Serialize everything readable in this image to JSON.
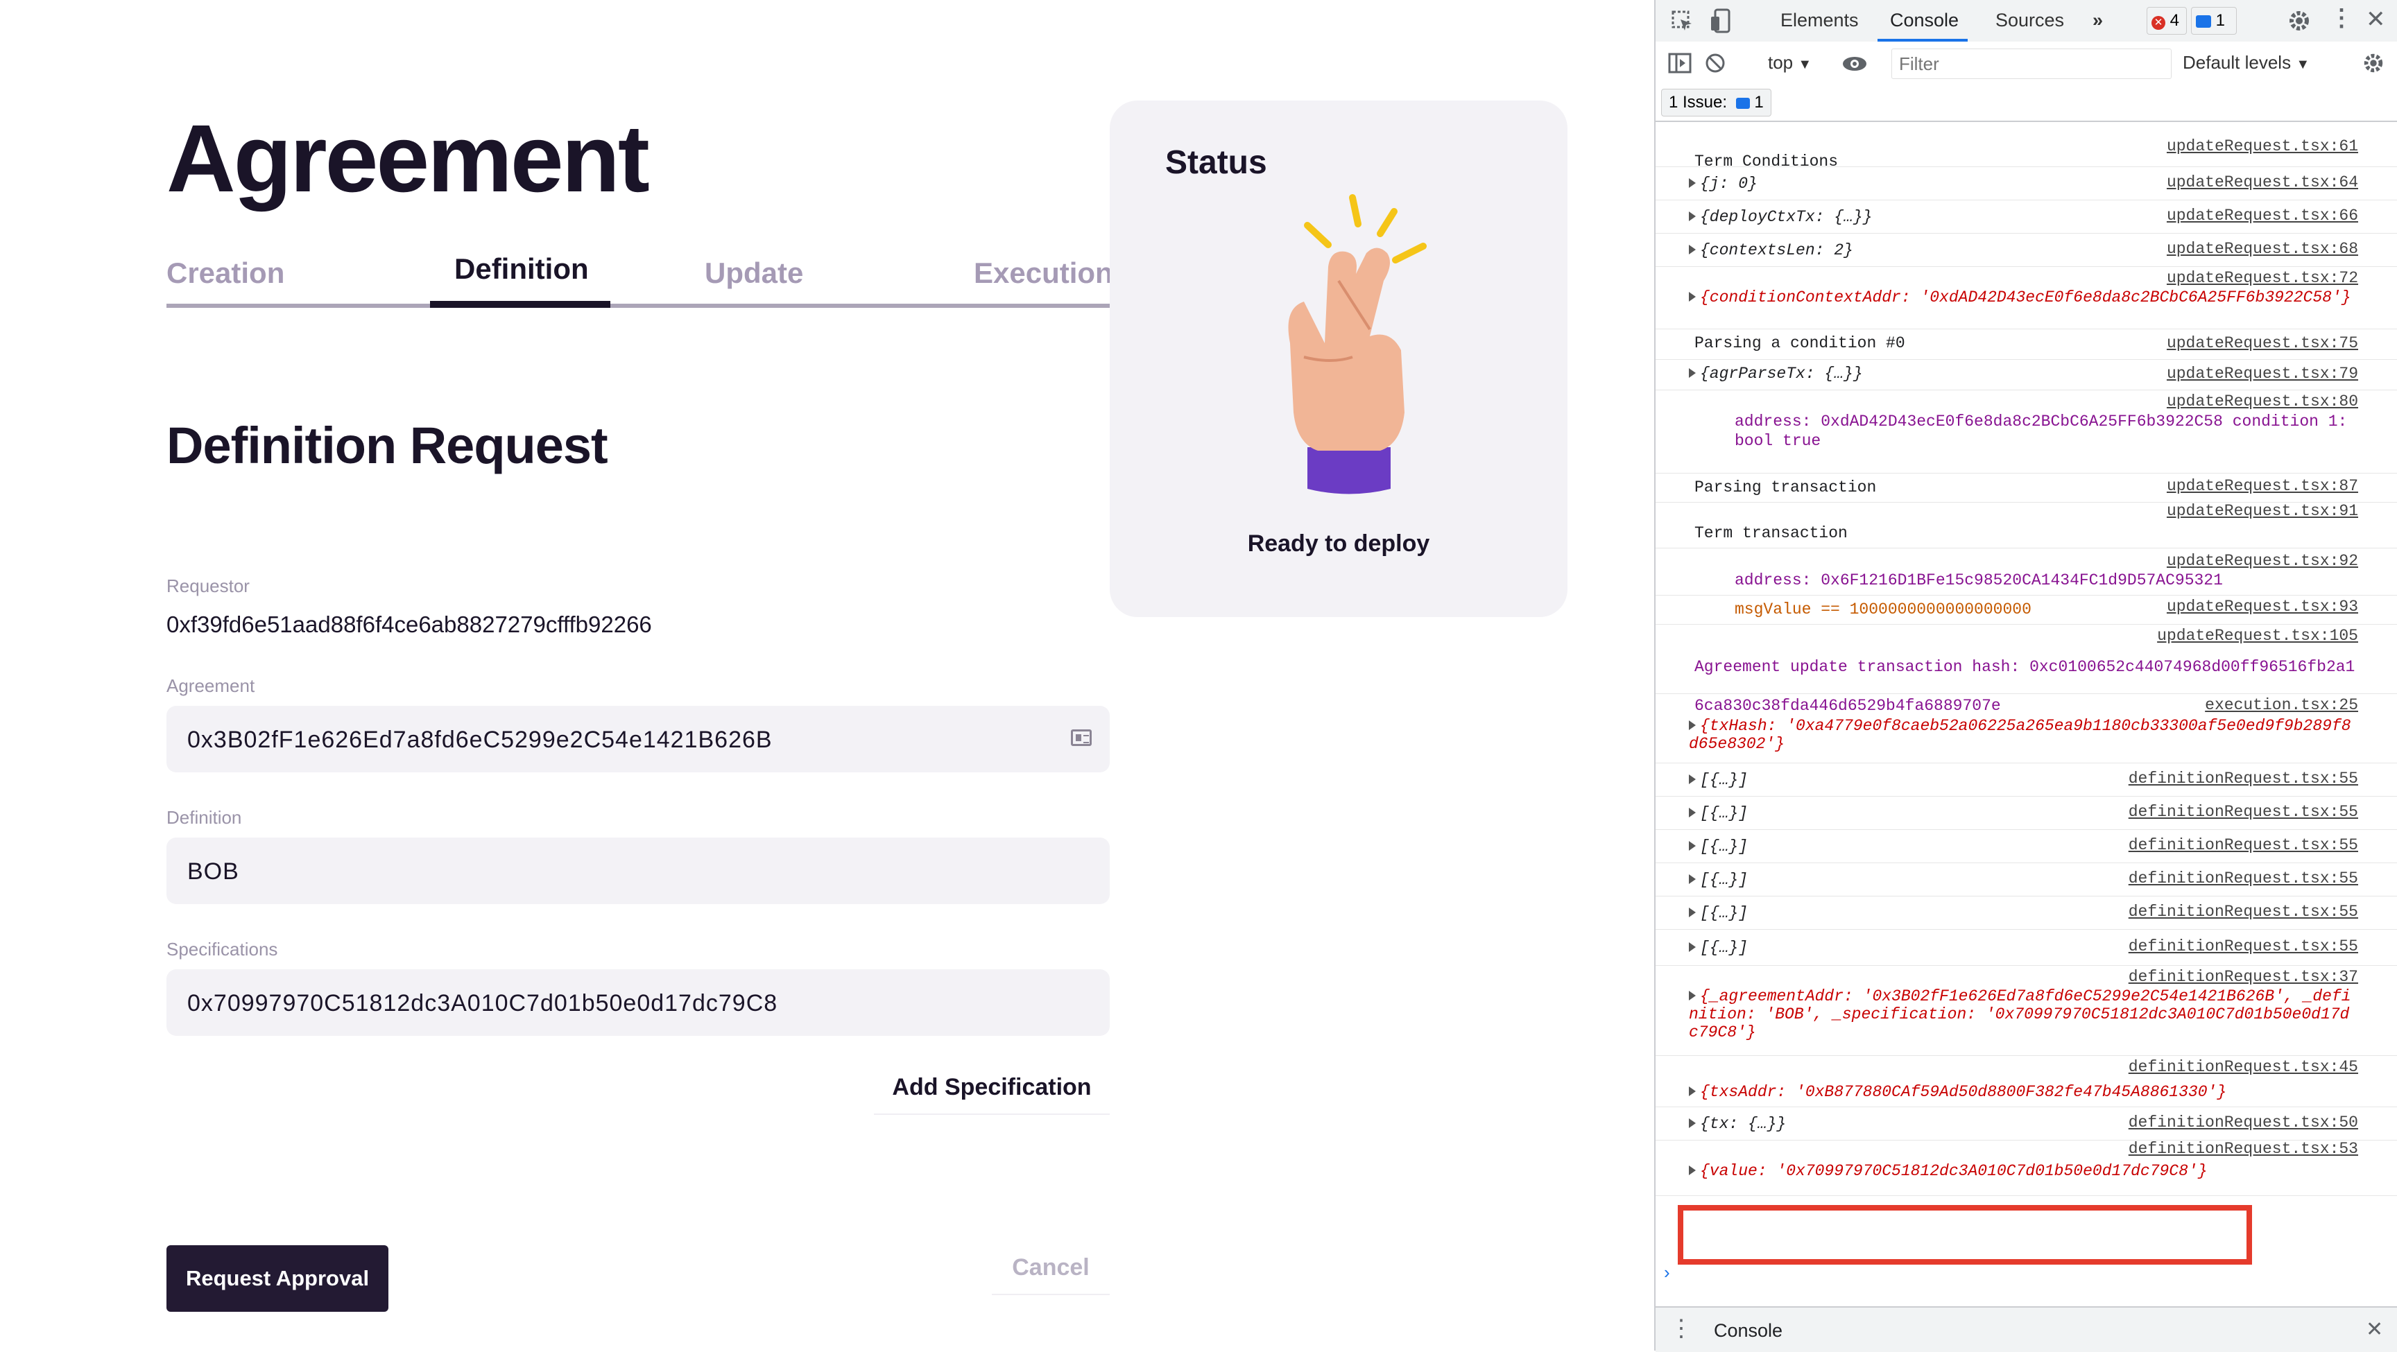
{
  "app": {
    "title": "Agreement",
    "tabs": [
      {
        "label": "Creation"
      },
      {
        "label": "Definition"
      },
      {
        "label": "Update"
      },
      {
        "label": "Execution"
      }
    ],
    "section_title": "Definition Request",
    "requestor": {
      "label": "Requestor",
      "value": "0xf39fd6e51aad88f6f4ce6ab8827279cfffb92266"
    },
    "agreement": {
      "label": "Agreement",
      "value": "0x3B02fF1e626Ed7a8fd6eC5299e2C54e1421B626B"
    },
    "definition": {
      "label": "Definition",
      "value": "BOB"
    },
    "specifications": {
      "label": "Specifications",
      "value": "0x70997970C51812dc3A010C7d01b50e0d17dc79C8"
    },
    "add_spec_label": "Add Specification",
    "request_label": "Request Approval",
    "cancel_label": "Cancel",
    "status": {
      "title": "Status",
      "caption": "Ready to deploy",
      "icon": "crossed-fingers-hand"
    }
  },
  "devtools": {
    "tabs": [
      "Elements",
      "Console",
      "Sources"
    ],
    "errors_count": "4",
    "messages_count": "1",
    "context": "top",
    "filter_placeholder": "Filter",
    "levels": "Default levels",
    "issues_label": "1 Issue:",
    "issues_count": "1",
    "drawer_tab": "Console",
    "logs": [
      {
        "src": "updateRequest.tsx:61",
        "text": "Term Conditions"
      },
      {
        "src": "updateRequest.tsx:64",
        "text": "{j: 0}"
      },
      {
        "src": "updateRequest.tsx:66",
        "text": "{deployCtxTx: {…}}"
      },
      {
        "src": "updateRequest.tsx:68",
        "text": "{contextsLen: 2}"
      },
      {
        "src": "updateRequest.tsx:72",
        "text": "{conditionContextAddr: '0xdAD42D43ecE0f6e8da8c2BCbC6A25FF6b3922C58'}"
      },
      {
        "src": "updateRequest.tsx:75",
        "text": "Parsing a condition #0"
      },
      {
        "src": "updateRequest.tsx:79",
        "text": "{agrParseTx: {…}}"
      },
      {
        "src": "updateRequest.tsx:80",
        "text": "address: 0xdAD42D43ecE0f6e8da8c2BCbC6A25FF6b3922C58 condition 1: bool true"
      },
      {
        "src": "updateRequest.tsx:87",
        "text": "Parsing transaction"
      },
      {
        "src": "updateRequest.tsx:91",
        "text": "Term transaction"
      },
      {
        "src": "updateRequest.tsx:92",
        "text": "address: 0x6F1216D1BFe15c98520CA1434FC1d9D57AC95321"
      },
      {
        "src": "updateRequest.tsx:93",
        "text": "msgValue == 1000000000000000000"
      },
      {
        "src": "updateRequest.tsx:105",
        "text": "Agreement update transaction hash: 0xc0100652c44074968d00ff96516fb2a16ca830c38fda446d6529b4fa6889707e"
      },
      {
        "src": "execution.tsx:25",
        "text": "{txHash: '0xa4779e0f8caeb52a06225a265ea9b1180cb33300af5e0ed9f9b289f8d65e8302'}"
      },
      {
        "src": "definitionRequest.tsx:55",
        "text": "[{…}]"
      },
      {
        "src": "definitionRequest.tsx:37",
        "text": "{_agreementAddr: '0x3B02fF1e626Ed7a8fd6eC5299e2C54e1421B626B', _definition: 'BOB', _specification: '0x70997970C51812dc3A010C7d01b50e0d17dc79C8'}"
      },
      {
        "src": "definitionRequest.tsx:45",
        "text": "{txsAddr: '0xB877880CAf59Ad50d8800F382fe47b45A8861330'}"
      },
      {
        "src": "definitionRequest.tsx:50",
        "text": "{tx: {…}}"
      },
      {
        "src": "definitionRequest.tsx:53",
        "text": "{value: '0x70997970C51812dc3A010C7d01b50e0d17dc79C8'}"
      }
    ]
  }
}
